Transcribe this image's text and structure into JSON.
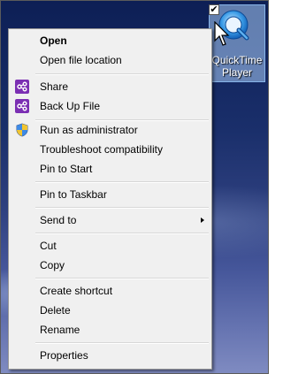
{
  "desktop": {
    "icon_label": "QuickTime Player",
    "checkbox_mark": "✔"
  },
  "menu": {
    "items": [
      {
        "label": "Open"
      },
      {
        "label": "Open file location"
      },
      {
        "label": "Share"
      },
      {
        "label": "Back Up File"
      },
      {
        "label": "Run as administrator"
      },
      {
        "label": "Troubleshoot compatibility"
      },
      {
        "label": "Pin to Start"
      },
      {
        "label": "Pin to Taskbar"
      },
      {
        "label": "Send to"
      },
      {
        "label": "Cut"
      },
      {
        "label": "Copy"
      },
      {
        "label": "Create shortcut"
      },
      {
        "label": "Delete"
      },
      {
        "label": "Rename"
      },
      {
        "label": "Properties"
      }
    ]
  },
  "colors": {
    "share_icon": "#7b2fb3",
    "menu_bg": "#f0f0f0",
    "selection_bg": "#aecbf2"
  }
}
